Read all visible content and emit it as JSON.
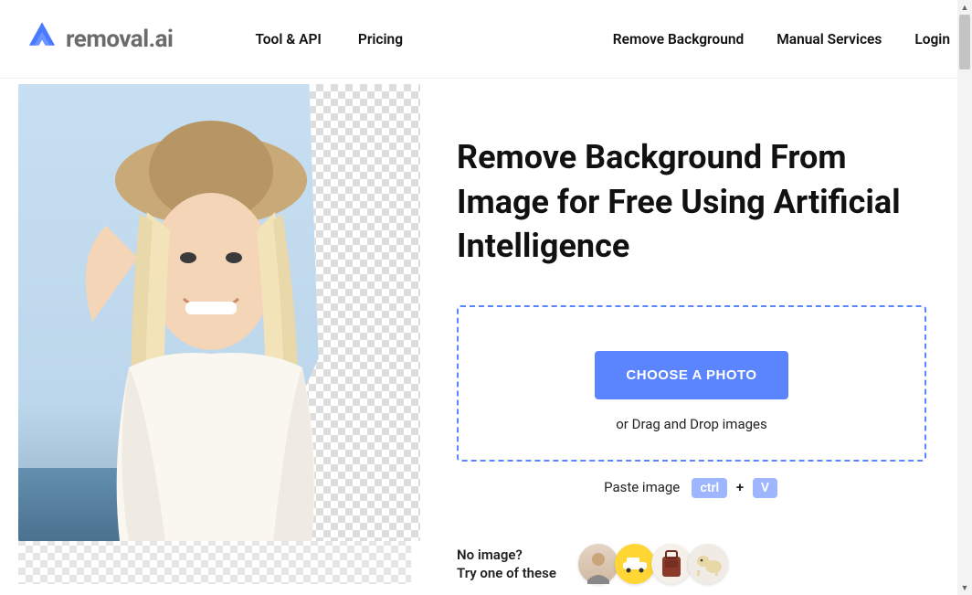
{
  "header": {
    "logo_text": "removal.ai",
    "nav_primary": [
      {
        "label": "Tool & API"
      },
      {
        "label": "Pricing"
      }
    ],
    "nav_secondary": [
      {
        "label": "Remove Background"
      },
      {
        "label": "Manual Services"
      },
      {
        "label": "Login"
      }
    ]
  },
  "hero": {
    "headline": "Remove Background From Image for Free Using Artificial Intelligence",
    "choose_button": "CHOOSE A PHOTO",
    "drop_text": "or Drag and Drop images",
    "paste_label": "Paste image",
    "kbd_ctrl": "ctrl",
    "kbd_plus": "+",
    "kbd_v": "V",
    "try_line1": "No image?",
    "try_line2": "Try one of these",
    "sample_colors": {
      "brand_blue": "#5a85ff",
      "kbd_blue": "#9db6ff"
    }
  }
}
